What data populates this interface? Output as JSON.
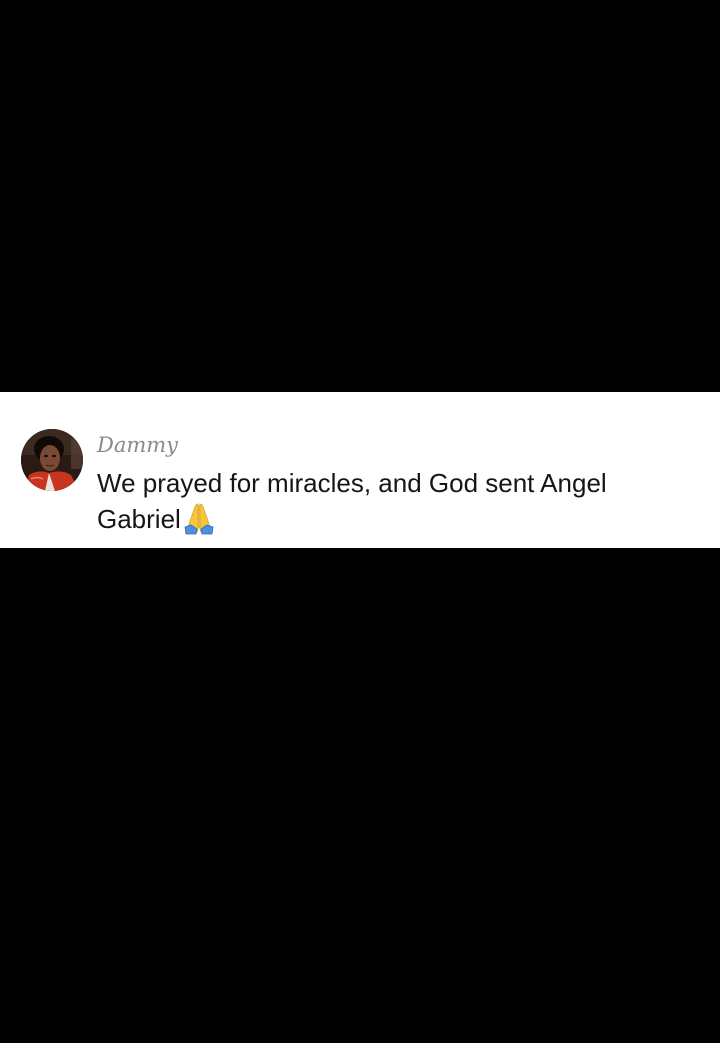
{
  "comment": {
    "username": "Dammy",
    "text": "We prayed for miracles, and God sent Angel Gabriel",
    "emoji": "folded-hands",
    "avatar_icon": "user-avatar"
  },
  "colors": {
    "background": "#000000",
    "card": "#ffffff",
    "username": "#8a8a8a",
    "text": "#161616",
    "avatar_jacket": "#c8341f"
  }
}
